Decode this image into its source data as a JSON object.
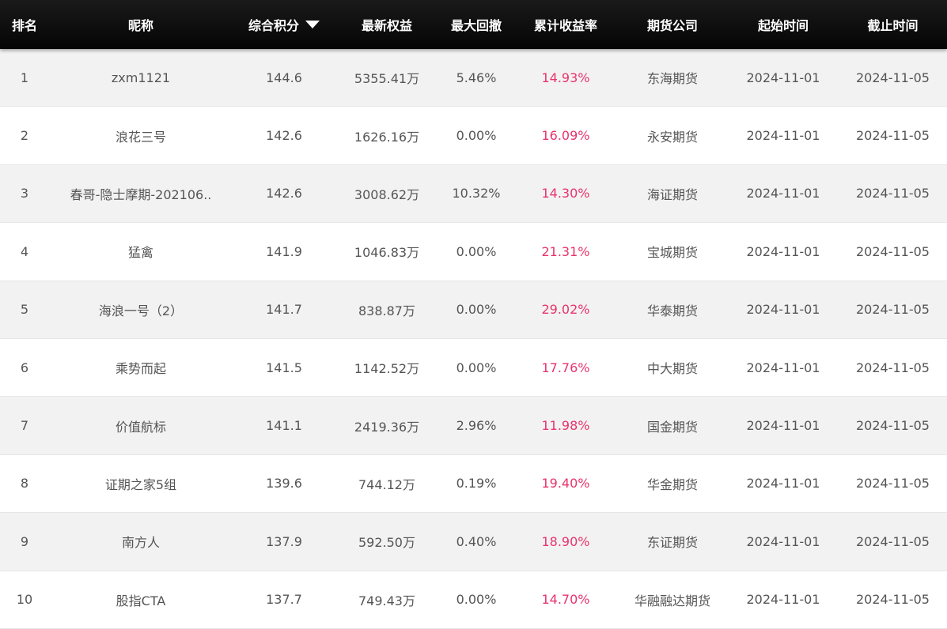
{
  "columns": [
    "排名",
    "昵称",
    "综合积分",
    "最新权益",
    "最大回撤",
    "累计收益率",
    "期货公司",
    "起始时间",
    "截止时间"
  ],
  "accent_color": "#e8336d",
  "rows": [
    {
      "rank": "1",
      "nickname": "zxm1121",
      "score": "144.6",
      "equity": "5355.41万",
      "drawdown": "5.46%",
      "return": "14.93%",
      "company": "东海期货",
      "start": "2024-11-01",
      "end": "2024-11-05"
    },
    {
      "rank": "2",
      "nickname": "浪花三号",
      "score": "142.6",
      "equity": "1626.16万",
      "drawdown": "0.00%",
      "return": "16.09%",
      "company": "永安期货",
      "start": "2024-11-01",
      "end": "2024-11-05"
    },
    {
      "rank": "3",
      "nickname": "春哥-隐士摩期-202106..",
      "score": "142.6",
      "equity": "3008.62万",
      "drawdown": "10.32%",
      "return": "14.30%",
      "company": "海证期货",
      "start": "2024-11-01",
      "end": "2024-11-05"
    },
    {
      "rank": "4",
      "nickname": "猛禽",
      "score": "141.9",
      "equity": "1046.83万",
      "drawdown": "0.00%",
      "return": "21.31%",
      "company": "宝城期货",
      "start": "2024-11-01",
      "end": "2024-11-05"
    },
    {
      "rank": "5",
      "nickname": "海浪一号（2）",
      "score": "141.7",
      "equity": "838.87万",
      "drawdown": "0.00%",
      "return": "29.02%",
      "company": "华泰期货",
      "start": "2024-11-01",
      "end": "2024-11-05"
    },
    {
      "rank": "6",
      "nickname": "乘势而起",
      "score": "141.5",
      "equity": "1142.52万",
      "drawdown": "0.00%",
      "return": "17.76%",
      "company": "中大期货",
      "start": "2024-11-01",
      "end": "2024-11-05"
    },
    {
      "rank": "7",
      "nickname": "价值航标",
      "score": "141.1",
      "equity": "2419.36万",
      "drawdown": "2.96%",
      "return": "11.98%",
      "company": "国金期货",
      "start": "2024-11-01",
      "end": "2024-11-05"
    },
    {
      "rank": "8",
      "nickname": "证期之家5组",
      "score": "139.6",
      "equity": "744.12万",
      "drawdown": "0.19%",
      "return": "19.40%",
      "company": "华金期货",
      "start": "2024-11-01",
      "end": "2024-11-05"
    },
    {
      "rank": "9",
      "nickname": "南方人",
      "score": "137.9",
      "equity": "592.50万",
      "drawdown": "0.40%",
      "return": "18.90%",
      "company": "东证期货",
      "start": "2024-11-01",
      "end": "2024-11-05"
    },
    {
      "rank": "10",
      "nickname": "股指CTA",
      "score": "137.7",
      "equity": "749.43万",
      "drawdown": "0.00%",
      "return": "14.70%",
      "company": "华融融达期货",
      "start": "2024-11-01",
      "end": "2024-11-05"
    }
  ]
}
